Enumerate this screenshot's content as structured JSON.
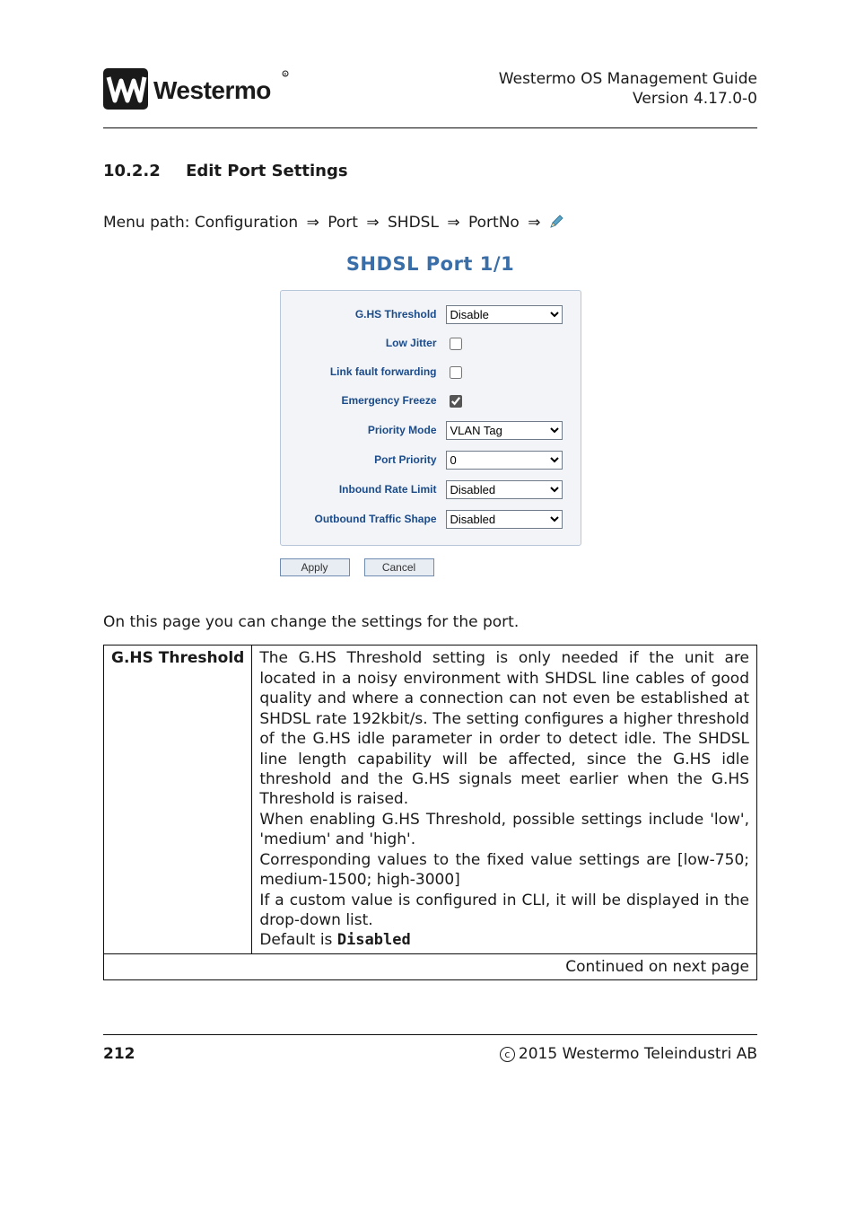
{
  "header": {
    "brand": "Westermo",
    "doc_title": "Westermo OS Management Guide",
    "doc_version": "Version 4.17.0-0"
  },
  "section": {
    "number": "10.2.2",
    "title": "Edit Port Settings"
  },
  "breadcrumb": {
    "prefix": "Menu path:",
    "parts": [
      "Configuration",
      "Port",
      "SHDSL",
      "PortNo"
    ],
    "arrow": "⇒",
    "edit_icon_name": "pencil-icon"
  },
  "form": {
    "title": "SHDSL Port 1/1",
    "fields": {
      "ghs_threshold": {
        "label": "G.HS Threshold",
        "value": "Disable"
      },
      "low_jitter": {
        "label": "Low Jitter",
        "checked": false
      },
      "link_fault": {
        "label": "Link fault forwarding",
        "checked": false
      },
      "emergency": {
        "label": "Emergency Freeze",
        "checked": true
      },
      "priority_mode": {
        "label": "Priority Mode",
        "value": "VLAN Tag"
      },
      "port_priority": {
        "label": "Port Priority",
        "value": "0"
      },
      "inbound": {
        "label": "Inbound Rate Limit",
        "value": "Disabled"
      },
      "outbound": {
        "label": "Outbound Traffic Shape",
        "value": "Disabled"
      }
    },
    "buttons": {
      "apply": "Apply",
      "cancel": "Cancel"
    }
  },
  "description": "On this page you can change the settings for the port.",
  "table": {
    "row_header": "G.HS Threshold",
    "body_parts": {
      "p1": "The G.HS Threshold setting is only needed if the unit are located in a noisy environment with SHDSL line cables of good quality and where a connection can not even be established at SHDSL rate 192kbit/s. The setting conﬁgures a higher threshold of the G.HS idle parameter in order to detect idle. The SHDSL line length capability will be affected, since the G.HS idle threshold and the G.HS signals meet earlier when the G.HS Threshold is raised.",
      "p2": "When enabling G.HS Threshold, possible settings include 'low', 'medium' and 'high'.",
      "p3": "Corresponding values to the ﬁxed value settings are [low-750; medium-1500; high-3000]",
      "p4": "If a custom value is conﬁgured in CLI, it will be displayed in the drop-down list.",
      "p5a": "Default is ",
      "p5b": "Disabled"
    },
    "continued": "Continued on next page"
  },
  "footer": {
    "page_number": "212",
    "copyright": "2015 Westermo Teleindustri AB"
  }
}
